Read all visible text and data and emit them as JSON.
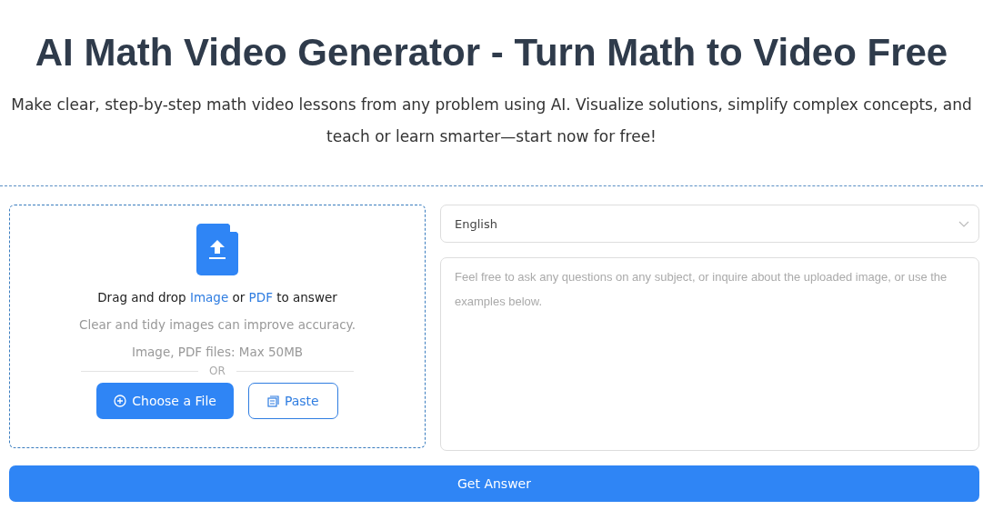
{
  "title": "AI Math Video Generator - Turn Math to Video Free",
  "subtitle": "Make clear, step-by-step math video lessons from any problem using AI. Visualize solutions, simplify complex concepts, and teach or learn smarter—start now for free!",
  "upload": {
    "drop_text": [
      {
        "kind": "plain",
        "text": "Drag and drop "
      },
      {
        "kind": "link",
        "text": "Image"
      },
      {
        "kind": "plain",
        "text": " or "
      },
      {
        "kind": "link",
        "text": "PDF"
      },
      {
        "kind": "plain",
        "text": " to answer"
      }
    ],
    "hint": "Clear and tidy images can improve accuracy.",
    "limits": "Image, PDF files: Max 50MB",
    "separator": "OR",
    "buttons": [
      {
        "kind": "primary",
        "label": "Choose a File"
      },
      {
        "kind": "outline",
        "label": "Paste"
      }
    ]
  },
  "language": {
    "value": "English"
  },
  "question": {
    "placeholder": "Feel free to ask any questions on any subject, or inquire about the uploaded image, or use the examples below."
  },
  "submit": "Get Answer"
}
